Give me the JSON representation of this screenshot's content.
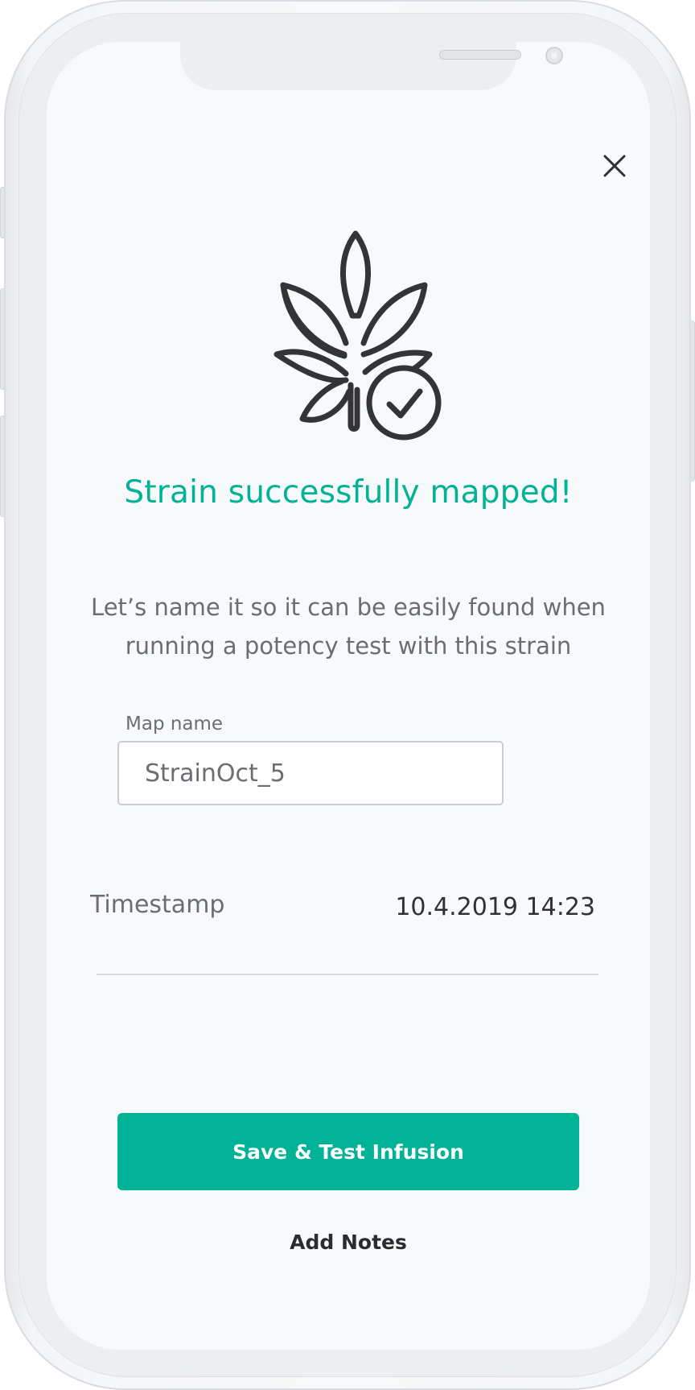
{
  "header": {
    "close_icon": "close-icon"
  },
  "hero": {
    "icon": "cannabis-leaf-check-icon"
  },
  "main": {
    "title": "Strain successfully mapped!",
    "subtitle": "Let’s name it so it can be easily found when running a potency test with this strain"
  },
  "map_name": {
    "label": "Map name",
    "value": "StrainOct_5"
  },
  "timestamp": {
    "label": "Timestamp",
    "value": "10.4.2019 14:23"
  },
  "actions": {
    "primary_label": "Save & Test Infusion",
    "secondary_label": "Add Notes"
  },
  "colors": {
    "accent": "#00b296",
    "text_primary": "#2f3133",
    "text_secondary": "#6b6d70",
    "screen_background": "#f8f9fa"
  }
}
